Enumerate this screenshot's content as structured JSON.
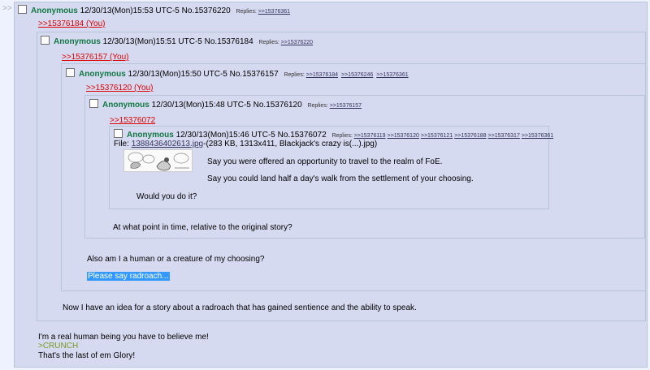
{
  "post1": {
    "name": "Anonymous",
    "datetime": "12/30/13(Mon)15:53 UTC-5 No.15376220",
    "replies_label": "Replies:",
    "replies": [
      ">>15376361"
    ],
    "quote": ">>15376184 (You)",
    "lines": [
      "I'm a real human being you have to believe me!",
      ">CRUNCH",
      "That's the last of em Glory!"
    ]
  },
  "post2": {
    "name": "Anonymous",
    "datetime": "12/30/13(Mon)15:51 UTC-5 No.15376184",
    "replies_label": "Replies:",
    "replies": [
      ">>15376220"
    ],
    "quote": ">>15376157 (You)",
    "lines": [
      "Now I have an idea for a story about a radroach that has gained sentience and the ability to speak."
    ]
  },
  "post3": {
    "name": "Anonymous",
    "datetime": "12/30/13(Mon)15:50 UTC-5 No.15376157",
    "replies_label": "Replies:",
    "replies": [
      ">>15376184",
      ">>15376246",
      ">>15376361"
    ],
    "quote": ">>15376120 (You)",
    "lines": [
      "Also am I a human or a creature of my choosing?",
      "Please say radroach..."
    ]
  },
  "post4": {
    "name": "Anonymous",
    "datetime": "12/30/13(Mon)15:48 UTC-5 No.15376120",
    "replies_label": "Replies:",
    "replies": [
      ">>15376157"
    ],
    "quote": ">>15376072",
    "lines": [
      "At what point in time, relative to the original story?"
    ]
  },
  "post5": {
    "name": "Anonymous",
    "datetime": "12/30/13(Mon)15:46 UTC-5 No.15376072",
    "replies_label": "Replies:",
    "replies": [
      ">>15376119",
      ">>15376120",
      ">>15376121",
      ">>15376188",
      ">>15376317",
      ">>15376361"
    ],
    "file_label": "File:",
    "file_name": "1388436402613.jpg",
    "file_meta": "-(283 KB, 1313x411, Blackjack's crazy is(...).jpg)",
    "lines": [
      "Say you were offered an opportunity to travel to the realm of FoE.",
      "Say you could land half a day's walk from the settlement of your choosing.",
      "Would you do it?"
    ]
  },
  "nav": {
    "arrows": ">>"
  },
  "colors": {
    "post_bg": "#D6DAF0",
    "page_bg": "#EEF2FF",
    "name": "#117743",
    "quotelink": "#DD0000",
    "greentext": "#789922",
    "selection": "#3399FF"
  }
}
